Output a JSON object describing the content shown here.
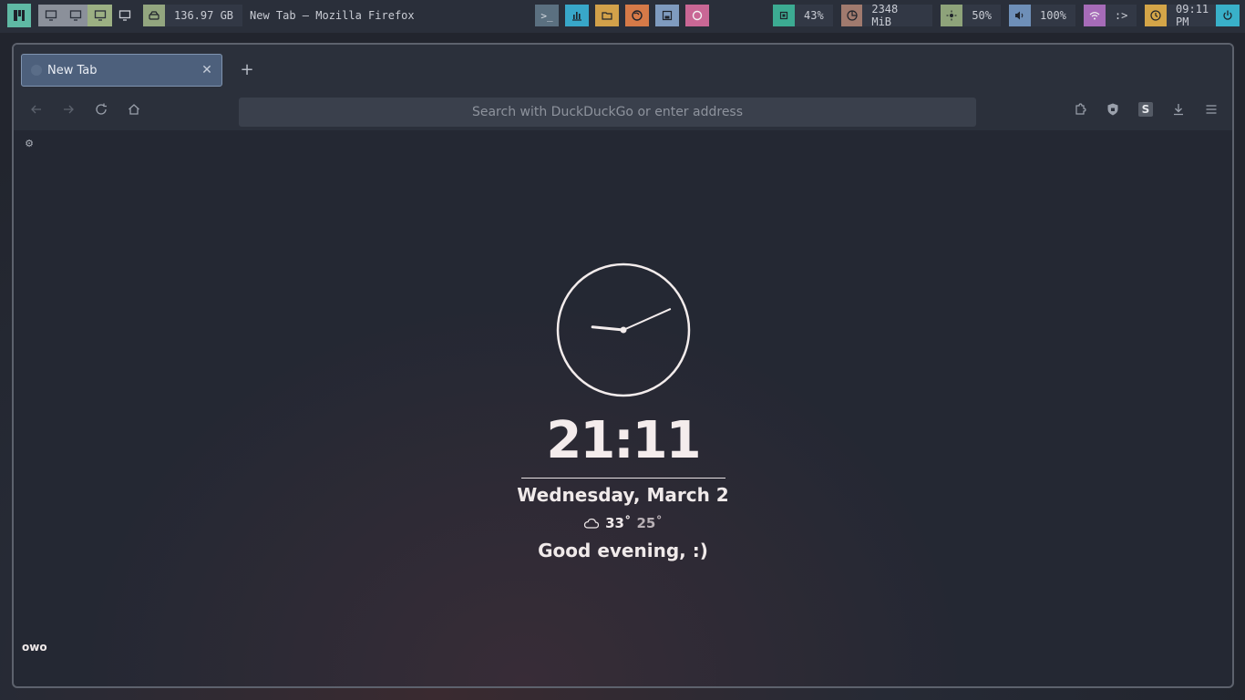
{
  "topbar": {
    "disk_value": "136.97 GB",
    "window_title": "New Tab — Mozilla Firefox",
    "launchers": [
      {
        "name": "terminal-icon",
        "color": "#5b7080",
        "glyph": ">_"
      },
      {
        "name": "chart-icon",
        "color": "#38a7c9"
      },
      {
        "name": "folder-icon",
        "color": "#d2a14a"
      },
      {
        "name": "firefox-icon",
        "color": "#d67a48"
      },
      {
        "name": "save-icon",
        "color": "#7f9bbf"
      },
      {
        "name": "record-icon",
        "color": "#c96795"
      }
    ],
    "cpu": {
      "value": "43%",
      "color": "#3cab92"
    },
    "memory": {
      "value": "2348 MiB",
      "color": "#a07a6e"
    },
    "brightness": {
      "value": "50%",
      "color": "#8ea37a"
    },
    "volume": {
      "value": "100%",
      "color": "#6e8fb8"
    },
    "network": {
      "value": ":>",
      "color": "#a66bb8"
    },
    "clock": {
      "value": "09:11 PM",
      "color": "#d4a548"
    }
  },
  "browser": {
    "tab_title": "New Tab",
    "url_placeholder": "Search with DuckDuckGo or enter address"
  },
  "newtab": {
    "clock": {
      "hour": 21,
      "minute": 11
    },
    "time": "21:11",
    "date": "Wednesday, March 2",
    "weather_high": "33˚",
    "weather_low": "25˚",
    "greeting": "Good evening, :)",
    "footer": "owo"
  }
}
